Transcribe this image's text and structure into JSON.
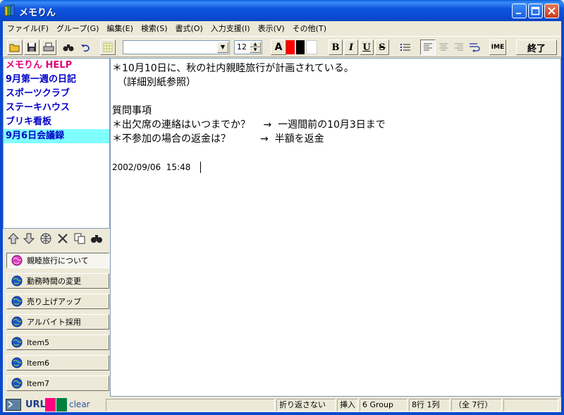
{
  "window": {
    "title": "メモりん"
  },
  "menu": [
    "ファイル(F)",
    "グループ(G)",
    "編集(E)",
    "検索(S)",
    "書式(O)",
    "入力支援(I)",
    "表示(V)",
    "その他(T)"
  ],
  "toolbar": {
    "font_name": "",
    "font_size": "12",
    "color_a": "A",
    "bold": "B",
    "italic": "I",
    "underline": "U",
    "strike": "S",
    "ime": "IME",
    "exit": "終了",
    "colors": {
      "red": "#ff0000",
      "black": "#000000",
      "white": "#ffffff",
      "font_a": "#000000"
    }
  },
  "memos": [
    {
      "label": "メモりん HELP",
      "style": "help"
    },
    {
      "label": "9月第一週の日記",
      "style": "normal"
    },
    {
      "label": "スポーツクラブ",
      "style": "normal"
    },
    {
      "label": "ステーキハウス",
      "style": "normal"
    },
    {
      "label": "ブリキ看板",
      "style": "normal"
    },
    {
      "label": "9月6日会議録",
      "style": "selected"
    }
  ],
  "groups": [
    {
      "label": "親睦旅行について",
      "icon": "pink-globe-icon",
      "active": true
    },
    {
      "label": "勤務時間の変更",
      "icon": "blue-globe-icon",
      "active": false
    },
    {
      "label": "売り上げアップ",
      "icon": "blue-globe-icon",
      "active": false
    },
    {
      "label": "アルバイト採用",
      "icon": "blue-globe-icon",
      "active": false
    },
    {
      "label": "Item5",
      "icon": "blue-globe-icon",
      "active": false
    },
    {
      "label": "Item6",
      "icon": "blue-globe-icon",
      "active": false
    },
    {
      "label": "Item7",
      "icon": "blue-globe-icon",
      "active": false
    }
  ],
  "editor": {
    "lines": [
      "＊10月10日に、秋の社内親睦旅行が計画されている。",
      "　（詳細別紙参照）",
      "",
      "質問事項",
      "＊出欠席の連絡はいつまでか？　 →  一週間前の10月3日まで",
      "＊不参加の場合の返金は？　　　→  半額を返金",
      "",
      "2002/09/06  15:48"
    ]
  },
  "status": {
    "url": "URL",
    "clear": "clear",
    "wrap": "折り返さない",
    "mode": "挿入",
    "group": "6 Group",
    "position": "8行  1列",
    "total": "（全 7行）",
    "colors": {
      "pink": "#ff0080",
      "green": "#008040"
    }
  }
}
